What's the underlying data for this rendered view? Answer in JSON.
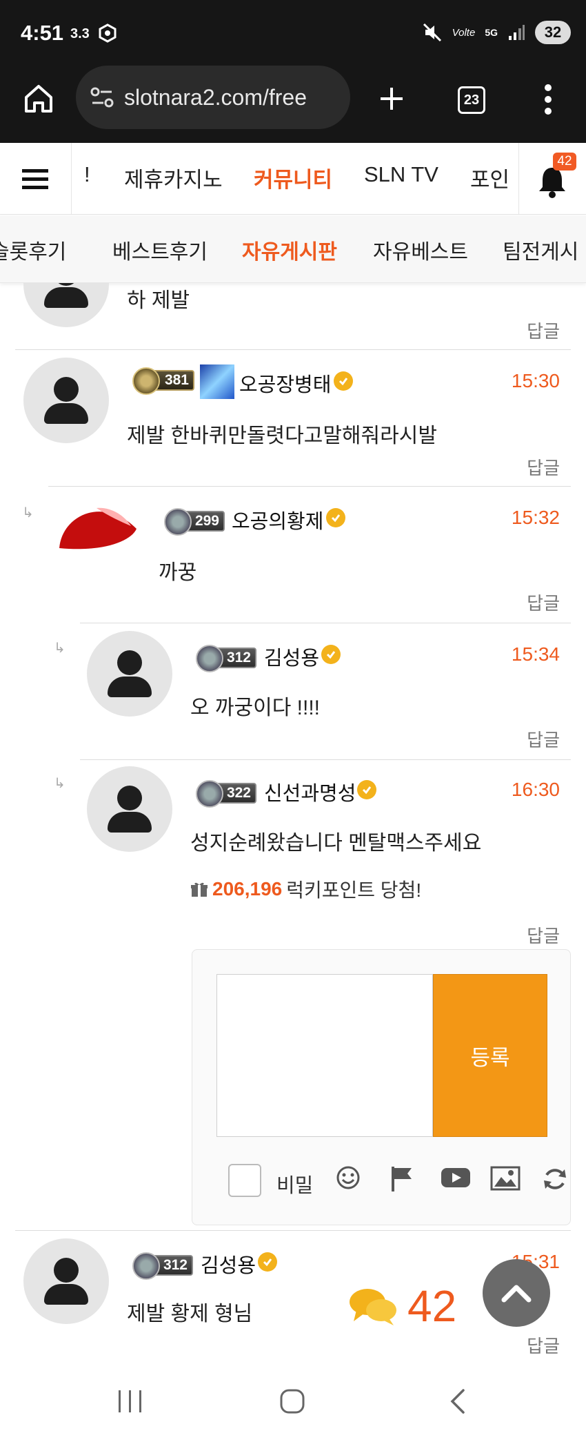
{
  "status_bar": {
    "time": "4:51",
    "speed": "3.3",
    "battery": "32"
  },
  "browser": {
    "url": "slotnara2.com/free",
    "tab_count": "23"
  },
  "site_nav": {
    "items": [
      "!",
      "제휴카지노",
      "커뮤니티",
      "SLN TV",
      "포인"
    ],
    "active": "커뮤니티",
    "notification_count": "42"
  },
  "sub_nav": {
    "items": [
      "슬롯후기",
      "베스트후기",
      "자유게시판",
      "자유베스트",
      "팀전게시"
    ],
    "active": "자유게시판"
  },
  "comments": [
    {
      "text_fragment": "하 제발",
      "reply_label": "답글"
    },
    {
      "level": "381",
      "username": "오공장병태",
      "time": "15:30",
      "text": "제발 한바퀴만돌렷다고말해줘라시발",
      "reply_label": "답글"
    },
    {
      "level": "299",
      "username": "오공의황제",
      "time": "15:32",
      "text": "까꿍",
      "reply_label": "답글"
    },
    {
      "level": "312",
      "username": "김성용",
      "time": "15:34",
      "text": "오 까궁이다 !!!!",
      "reply_label": "답글"
    },
    {
      "level": "322",
      "username": "신선과명성",
      "time": "16:30",
      "text": "성지순례왔습니다 멘탈맥스주세요",
      "lucky_points": "206,196",
      "lucky_label": "럭키포인트 당첨!",
      "reply_label": "답글"
    },
    {
      "level": "312",
      "username": "김성용",
      "time": "15:31",
      "text": "제발 황제 형님",
      "reply_label": "답글"
    }
  ],
  "reply_form": {
    "submit_label": "등록",
    "secret_label": "비밀"
  },
  "comment_count": "42",
  "colors": {
    "accent": "#ee5a1e",
    "submit": "#f39715"
  }
}
